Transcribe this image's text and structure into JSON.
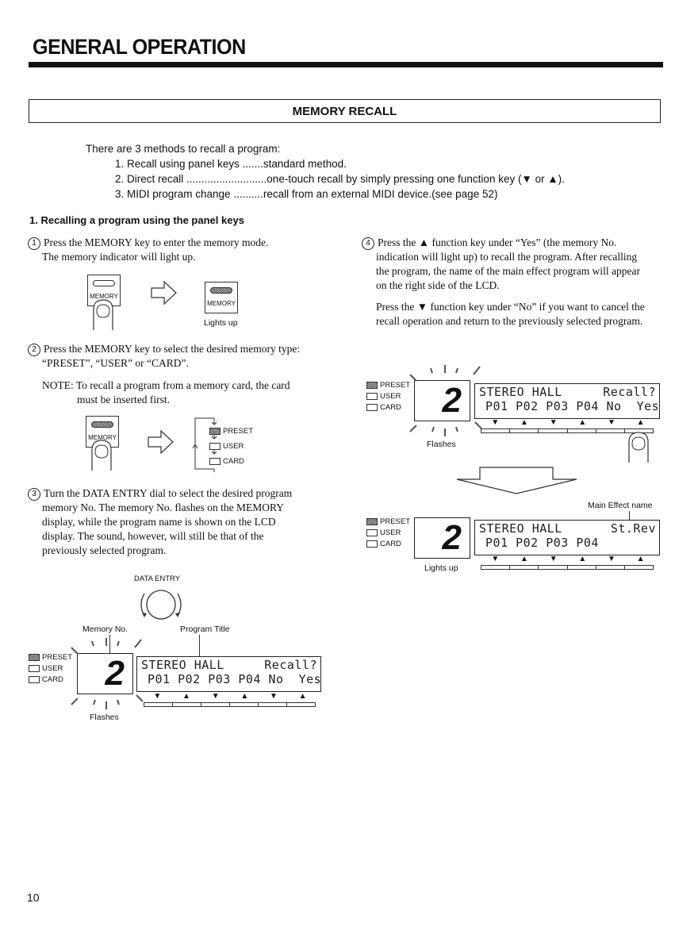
{
  "header": {
    "title": "GENERAL OPERATION",
    "section_title": "MEMORY RECALL"
  },
  "intro": {
    "lead": "There are 3 methods to recall a program:",
    "methods": [
      {
        "label": "1. Recall using panel keys .......",
        "desc": "standard method."
      },
      {
        "label": "2. Direct recall ...........................",
        "desc": "one-touch recall by simply pressing one function key (▼ or ▲)."
      },
      {
        "label": "3. MIDI program change ..........",
        "desc": "recall from an external MIDI device.(see page 52)"
      }
    ]
  },
  "subheading": "1. Recalling a program using the panel keys",
  "steps": {
    "step1": {
      "num": "1",
      "lines": [
        "Press the MEMORY key to enter the memory mode.",
        "The memory indicator will light up."
      ],
      "key_label": "MEMORY",
      "caption": "Lights up"
    },
    "step2": {
      "num": "2",
      "lines": [
        "Press the MEMORY key to select the desired memory type:",
        "“PRESET”, “USER” or “CARD”."
      ],
      "note_lines": [
        "NOTE: To recall a program from a memory card, the card",
        "must be inserted first."
      ],
      "key_label": "MEMORY",
      "cycle": [
        "PRESET",
        "USER",
        "CARD"
      ]
    },
    "step3": {
      "num": "3",
      "lines": [
        "Turn the DATA ENTRY dial to select the desired program",
        "memory No. The memory No. flashes on the MEMORY",
        "display, while the program name is shown on the LCD",
        "display. The sound, however, will still be that of the",
        "previously selected program."
      ],
      "dial_label": "DATA ENTRY",
      "memory_no_label": "Memory No.",
      "program_title_label": "Program Title",
      "flash_caption": "Flashes"
    },
    "step4": {
      "num": "4",
      "para1": [
        "Press the ▲ function key under “Yes” (the memory No.",
        "indication will light up) to recall the program. After recalling",
        "the program, the name of the main effect program will appear",
        "on the right side of the LCD."
      ],
      "para2": [
        "Press the ▼ function key under “No” if you want to cancel the",
        "recall operation and return to the previously selected program."
      ],
      "flash_caption": "Flashes",
      "lights_caption": "Lights up",
      "main_effect_label": "Main Effect name"
    }
  },
  "indicators": [
    "PRESET",
    "USER",
    "CARD"
  ],
  "active_indicator": "PRESET",
  "memory_digit": "2",
  "lcd_recall": {
    "line1_left": "STEREO HALL",
    "line1_right": "Recall?",
    "line2": "P01 P02 P03 P04 No  Yes"
  },
  "lcd_result": {
    "line1_left": "STEREO HALL",
    "line1_right": "St.Rev",
    "line2": "P01 P02 P03 P04"
  },
  "function_key_arrows": [
    "▼",
    "▲",
    "▼",
    "▲",
    "▼",
    "▲"
  ],
  "footer": {
    "page_number": "10"
  }
}
